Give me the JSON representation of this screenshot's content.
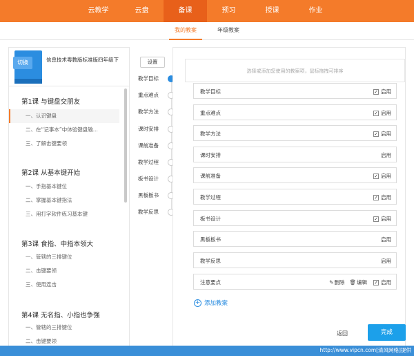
{
  "topnav": {
    "tabs": [
      {
        "label": "云教学"
      },
      {
        "label": "云盘"
      },
      {
        "label": "备课",
        "active": true
      },
      {
        "label": "预习"
      },
      {
        "label": "授课"
      },
      {
        "label": "作业"
      }
    ]
  },
  "subnav": {
    "tabs": [
      {
        "label": "我的教案",
        "active": true
      },
      {
        "label": "年级教案"
      }
    ]
  },
  "book": {
    "switch_label": "切换",
    "title": "信息技术粤教版标准版四年级下"
  },
  "lessons": [
    {
      "title": "第1课 与键盘交朋友",
      "topics": [
        "一、认识键盘",
        "二、在“记事本”中体验键盘输...",
        "三、了解击键要领"
      ]
    },
    {
      "title": "第2课 从基本键开始",
      "topics": [
        "一、手指基本键位",
        "二、掌握基本键指法",
        "三、用打字软件练习基本键"
      ]
    },
    {
      "title": "第3课 食指、中指本领大",
      "topics": [
        "一、管辖的三排键位",
        "二、击键要领",
        "三、使用连击"
      ]
    },
    {
      "title": "第4课 无名指、小指也争强",
      "topics": [
        "一、管辖的三排键位",
        "二、击键要领"
      ]
    }
  ],
  "settings_label": "设置",
  "steps": [
    "教学目标",
    "重点难点",
    "教学方法",
    "课时安排",
    "课前准备",
    "教学过程",
    "板书设计",
    "黑板板书",
    "教学反思"
  ],
  "hint_text": "选择或添加您使用的教案项，鼠标拖拽可排序",
  "enable_label": "启用",
  "rows": [
    {
      "name": "教学目标",
      "checked": true
    },
    {
      "name": "重点难点",
      "checked": true
    },
    {
      "name": "教学方法",
      "checked": true
    },
    {
      "name": "课时安排",
      "checked": false
    },
    {
      "name": "课前准备",
      "checked": true
    },
    {
      "name": "教学过程",
      "checked": true
    },
    {
      "name": "板书设计",
      "checked": true
    },
    {
      "name": "黑板板书",
      "checked": false
    },
    {
      "name": "教学反思",
      "checked": false
    },
    {
      "name": "注意要点",
      "checked": true,
      "custom": true
    }
  ],
  "row_actions": {
    "delete": "删除",
    "edit": "编辑"
  },
  "add_label": "添加教案",
  "back_label": "返回",
  "done_label": "完成",
  "watermark": "http://www.vipcn.com[清风网络]提供",
  "colors": {
    "brand_orange": "#f47b2a",
    "active_orange": "#e8601a",
    "accent_blue": "#1ca0ea",
    "footer_blue": "#3a8fd8"
  }
}
